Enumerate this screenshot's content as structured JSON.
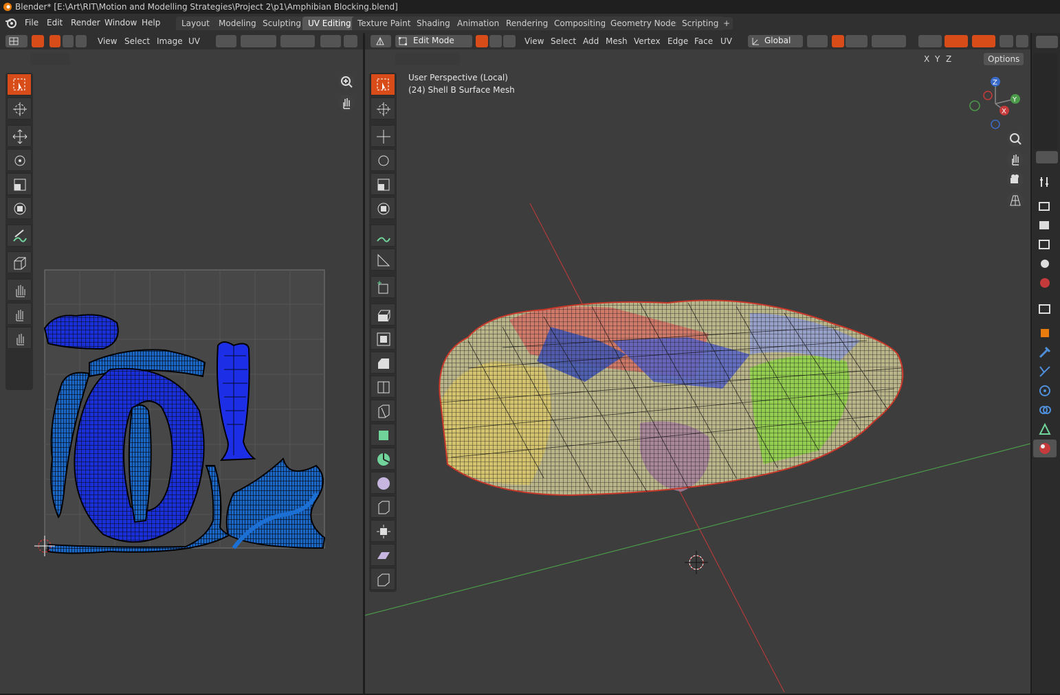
{
  "window": {
    "title": "Blender* [E:\\Art\\RIT\\Motion and Modelling Strategies\\Project 2\\p1\\Amphibian Blocking.blend]"
  },
  "menu": {
    "items": [
      "File",
      "Edit",
      "Render",
      "Window",
      "Help"
    ]
  },
  "workspaces": {
    "tabs": [
      "Layout",
      "Modeling",
      "Sculpting",
      "UV Editing",
      "Texture Paint",
      "Shading",
      "Animation",
      "Rendering",
      "Compositing",
      "Geometry Nodes",
      "Scripting"
    ],
    "active": "UV Editing",
    "add_label": "+"
  },
  "uv_editor": {
    "menus": [
      "View",
      "Select",
      "Image",
      "UV"
    ],
    "cursor_label": "2D cursor",
    "tools": [
      "select-box",
      "cursor",
      "move",
      "rotate",
      "scale",
      "transform",
      "annotate",
      "rip-region",
      "grab",
      "relax",
      "pinch"
    ]
  },
  "viewport": {
    "mode": "Edit Mode",
    "menus": [
      "View",
      "Select",
      "Add",
      "Mesh",
      "Vertex",
      "Edge",
      "Face",
      "UV"
    ],
    "orientation": "Global",
    "axes": [
      "X",
      "Y",
      "Z"
    ],
    "options_label": "Options",
    "info_line1": "User Perspective (Local)",
    "info_line2": "(24) Shell B Surface Mesh",
    "gizmo": {
      "z": "Z",
      "y": "Y",
      "x": "X"
    }
  },
  "colors": {
    "accent": "#4772b3",
    "active_tool": "#d84c1a",
    "uv_island": "#1b2fd8",
    "axis_x": "#b33a3a",
    "axis_y": "#4a9a4a",
    "axis_z": "#3a6bc9"
  }
}
